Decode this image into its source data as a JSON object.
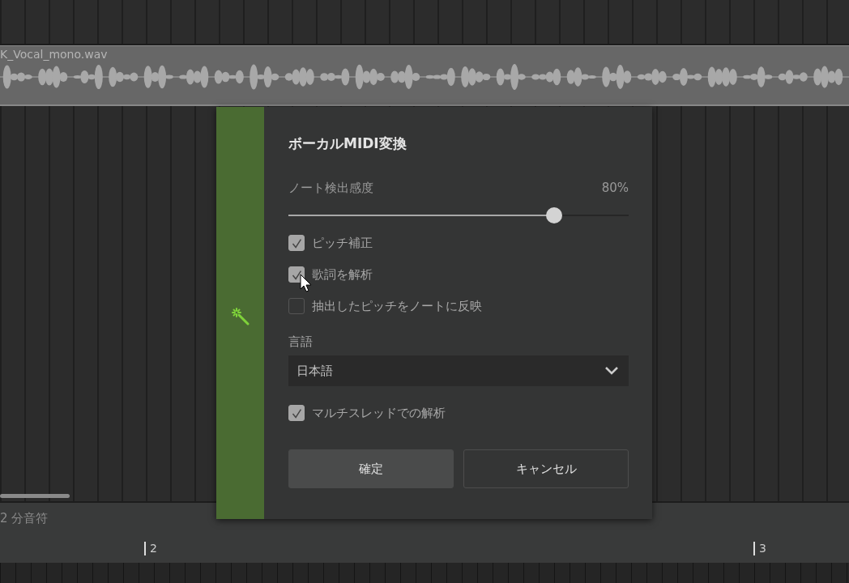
{
  "clip": {
    "name": "K_Vocal_mono.wav"
  },
  "dialog": {
    "title": "ボーカルMIDI変換",
    "slider": {
      "label": "ノート検出感度",
      "reading": "80%",
      "level": 0.78
    },
    "options": [
      {
        "label": "ピッチ補正",
        "checked": true
      },
      {
        "label": "歌詞を解析",
        "checked": true
      },
      {
        "label": "抽出したピッチをノートに反映",
        "checked": false
      }
    ],
    "language": {
      "label": "言語",
      "value": "日本語"
    },
    "multithread": {
      "label": "マルチスレッドでの解析",
      "checked": true
    },
    "buttons": [
      {
        "label": "確定",
        "kind": "primary"
      },
      {
        "label": "キャンセル",
        "kind": "secondary"
      }
    ]
  },
  "status": {
    "grid": "2 分音符"
  },
  "ruler": {
    "markers": [
      {
        "label": "2"
      },
      {
        "label": "3"
      }
    ]
  }
}
